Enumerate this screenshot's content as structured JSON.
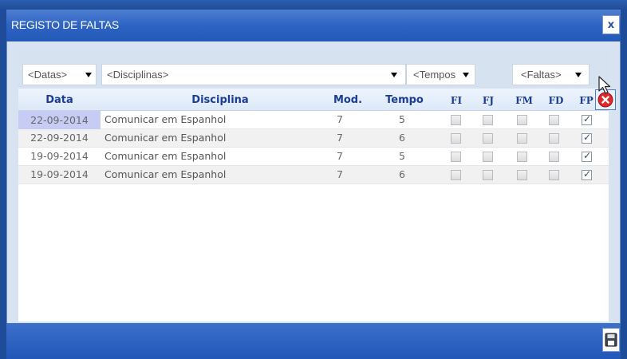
{
  "dialog": {
    "title": "REGISTO DE FALTAS",
    "close_label": "x"
  },
  "filters": {
    "datas": "<Datas>",
    "disciplinas": "<Disciplinas>",
    "tempos": "<Tempos",
    "faltas": "<Faltas>"
  },
  "columns": {
    "data": "Data",
    "disciplina": "Disciplina",
    "mod": "Mod.",
    "tempo": "Tempo",
    "fi": "FI",
    "fj": "FJ",
    "fm": "FM",
    "fd": "FD",
    "fp": "FP"
  },
  "rows": [
    {
      "data": "22-09-2014",
      "disciplina": "Comunicar em Espanhol",
      "mod": "7",
      "tempo": "5",
      "fi": false,
      "fj": false,
      "fm": false,
      "fd": false,
      "fp": true
    },
    {
      "data": "22-09-2014",
      "disciplina": "Comunicar em Espanhol",
      "mod": "7",
      "tempo": "6",
      "fi": false,
      "fj": false,
      "fm": false,
      "fd": false,
      "fp": true
    },
    {
      "data": "19-09-2014",
      "disciplina": "Comunicar em Espanhol",
      "mod": "7",
      "tempo": "5",
      "fi": false,
      "fj": false,
      "fm": false,
      "fd": false,
      "fp": true
    },
    {
      "data": "19-09-2014",
      "disciplina": "Comunicar em Espanhol",
      "mod": "7",
      "tempo": "6",
      "fi": false,
      "fj": false,
      "fm": false,
      "fd": false,
      "fp": true
    }
  ],
  "icons": {
    "delete": "delete-circle-icon",
    "save": "save-disk-icon",
    "cursor": "mouse-cursor-icon"
  },
  "colors": {
    "titlebar": "#2d63c3",
    "header_text": "#1a3e95",
    "delete_red": "#e0282b",
    "selected_cell": "#c7ccf5"
  }
}
